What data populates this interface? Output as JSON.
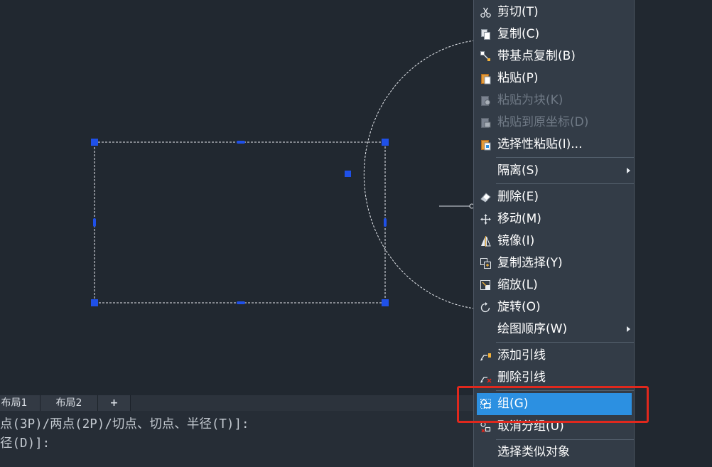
{
  "layout_tabs": [
    "布局1",
    "布局2",
    "+"
  ],
  "command_lines": [
    "点(3P)/两点(2P)/切点、切点、半径(T)]:",
    "径(D)]:"
  ],
  "context_menu": {
    "items": [
      {
        "label": "剪切(T)",
        "icon": "scissors-icon",
        "disabled": false
      },
      {
        "label": "复制(C)",
        "icon": "copy-icon",
        "disabled": false
      },
      {
        "label": "带基点复制(B)",
        "icon": "copy-with-basepoint-icon",
        "disabled": false
      },
      {
        "label": "粘贴(P)",
        "icon": "paste-icon",
        "disabled": false
      },
      {
        "label": "粘贴为块(K)",
        "icon": "paste-as-block-icon",
        "disabled": true
      },
      {
        "label": "粘贴到原坐标(D)",
        "icon": "paste-to-original-coords-icon",
        "disabled": true
      },
      {
        "label": "选择性粘贴(I)...",
        "icon": "paste-special-icon",
        "disabled": false
      },
      {
        "label": "隔离(S)",
        "submenu": true
      },
      {
        "label": "删除(E)",
        "icon": "eraser-icon",
        "disabled": false
      },
      {
        "label": "移动(M)",
        "icon": "move-icon",
        "disabled": false
      },
      {
        "label": "镜像(I)",
        "icon": "mirror-icon",
        "disabled": false
      },
      {
        "label": "复制选择(Y)",
        "icon": "copy-selection-icon",
        "disabled": false
      },
      {
        "label": "缩放(L)",
        "icon": "scale-icon",
        "disabled": false
      },
      {
        "label": "旋转(O)",
        "icon": "rotate-icon",
        "disabled": false
      },
      {
        "label": "绘图顺序(W)",
        "submenu": true
      },
      {
        "label": "添加引线",
        "icon": "add-leader-icon",
        "disabled": false
      },
      {
        "label": "删除引线",
        "icon": "remove-leader-icon",
        "disabled": false
      },
      {
        "label": "组(G)",
        "icon": "group-icon",
        "highlighted": true
      },
      {
        "label": "取消分组(U)",
        "icon": "ungroup-icon",
        "disabled": false
      },
      {
        "label": "选择类似对象"
      }
    ]
  },
  "colors": {
    "canvas_bg": "#212830",
    "menu_bg": "#333c47",
    "highlight": "#2c90e1",
    "grip": "#1f50e8",
    "annotation": "#e0281d"
  }
}
